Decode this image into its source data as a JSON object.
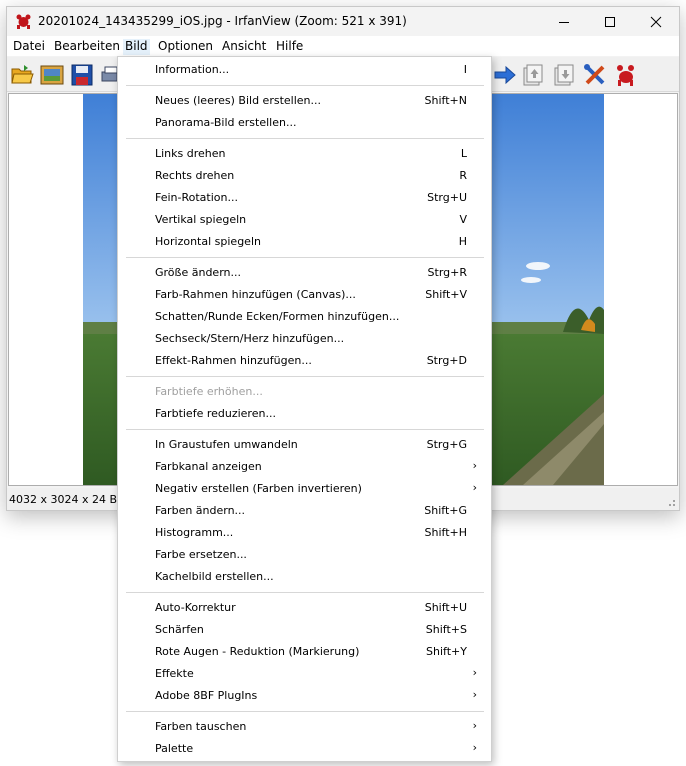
{
  "window": {
    "title": "20201024_143435299_iOS.jpg - IrfanView (Zoom: 521 x 391)",
    "controls": [
      "minimize",
      "maximize",
      "close"
    ]
  },
  "menubar": {
    "items": [
      {
        "label": "Datei"
      },
      {
        "label": "Bearbeiten"
      },
      {
        "label": "Bild",
        "active": true
      },
      {
        "label": "Optionen"
      },
      {
        "label": "Ansicht"
      },
      {
        "label": "Hilfe"
      }
    ]
  },
  "toolbar": {
    "buttons": [
      "open-folder-icon",
      "slideshow-icon",
      "save-icon",
      "print-icon",
      "next-arrow-icon",
      "page-up-icon",
      "page-down-icon",
      "tools-icon",
      "irfanview-logo-icon"
    ]
  },
  "status": {
    "info": "4032 x 3024 x 24 BPP"
  },
  "bild_menu": {
    "items": [
      {
        "label": "Information...",
        "shortcut": "I"
      },
      {
        "label": "Neues (leeres) Bild erstellen...",
        "shortcut": "Shift+N"
      },
      {
        "label": "Panorama-Bild erstellen...",
        "shortcut": ""
      },
      {
        "label": "Links drehen",
        "shortcut": "L"
      },
      {
        "label": "Rechts drehen",
        "shortcut": "R"
      },
      {
        "label": "Fein-Rotation...",
        "shortcut": "Strg+U"
      },
      {
        "label": "Vertikal spiegeln",
        "shortcut": "V"
      },
      {
        "label": "Horizontal spiegeln",
        "shortcut": "H"
      },
      {
        "label": "Größe ändern...",
        "shortcut": "Strg+R"
      },
      {
        "label": "Farb-Rahmen hinzufügen (Canvas)...",
        "shortcut": "Shift+V"
      },
      {
        "label": "Schatten/Runde Ecken/Formen hinzufügen...",
        "shortcut": ""
      },
      {
        "label": "Sechseck/Stern/Herz hinzufügen...",
        "shortcut": ""
      },
      {
        "label": "Effekt-Rahmen hinzufügen...",
        "shortcut": "Strg+D"
      },
      {
        "label": "Farbtiefe erhöhen...",
        "shortcut": "",
        "disabled": true
      },
      {
        "label": "Farbtiefe reduzieren...",
        "shortcut": ""
      },
      {
        "label": "In Graustufen umwandeln",
        "shortcut": "Strg+G"
      },
      {
        "label": "Farbkanal anzeigen",
        "shortcut": "",
        "submenu": true
      },
      {
        "label": "Negativ erstellen (Farben invertieren)",
        "shortcut": "",
        "submenu": true
      },
      {
        "label": "Farben ändern...",
        "shortcut": "Shift+G"
      },
      {
        "label": "Histogramm...",
        "shortcut": "Shift+H"
      },
      {
        "label": "Farbe ersetzen...",
        "shortcut": ""
      },
      {
        "label": "Kachelbild erstellen...",
        "shortcut": ""
      },
      {
        "label": "Auto-Korrektur",
        "shortcut": "Shift+U"
      },
      {
        "label": "Schärfen",
        "shortcut": "Shift+S"
      },
      {
        "label": "Rote Augen - Reduktion (Markierung)",
        "shortcut": "Shift+Y"
      },
      {
        "label": "Effekte",
        "shortcut": "",
        "submenu": true
      },
      {
        "label": "Adobe 8BF PlugIns",
        "shortcut": "",
        "submenu": true
      },
      {
        "label": "Farben tauschen",
        "shortcut": "",
        "submenu": true
      },
      {
        "label": "Palette",
        "shortcut": "",
        "submenu": true
      }
    ]
  },
  "colors": {
    "menu_highlight": "#e5f1fb",
    "disabled_text": "#a0a0a0",
    "sky": "#4a86d8",
    "field": "#3d6a2a"
  }
}
